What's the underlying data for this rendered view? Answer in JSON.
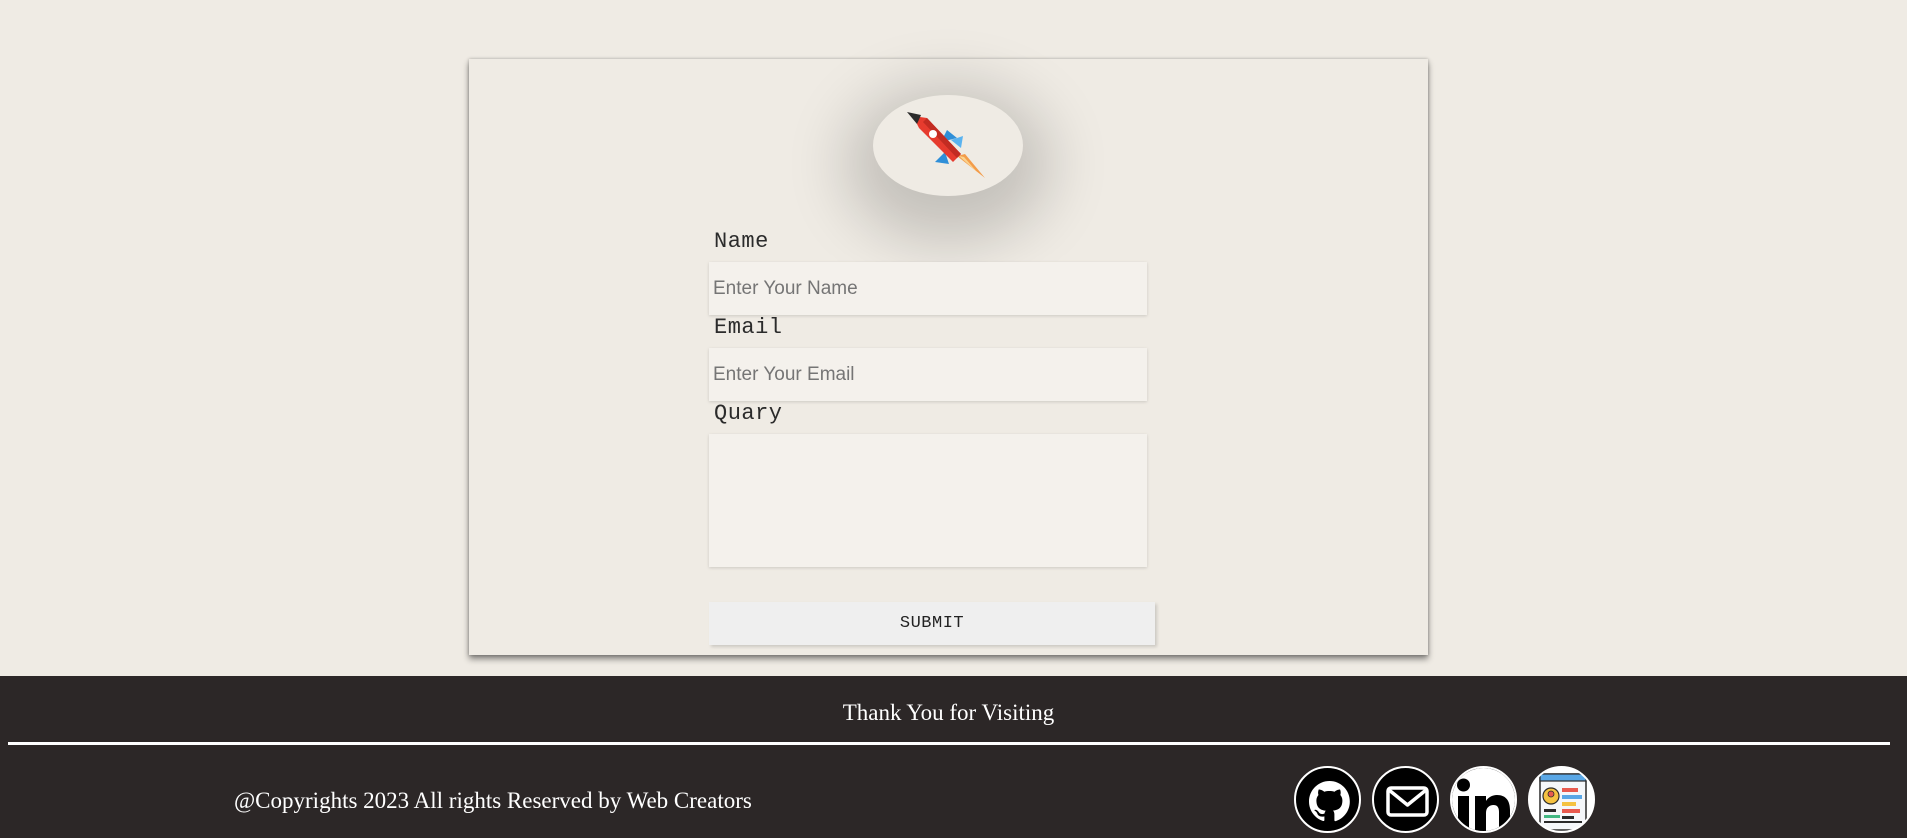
{
  "form": {
    "name_label": "Name",
    "name_placeholder": "Enter Your Name",
    "email_label": "Email",
    "email_placeholder": "Enter Your Email",
    "query_label": "Quary",
    "submit_label": "SUBMIT"
  },
  "footer": {
    "thanks": "Thank You for Visiting",
    "copyright": "@Copyrights 2023 All rights Reserved by Web Creators",
    "social_icons": [
      "github-icon",
      "mail-icon",
      "linkedin-icon",
      "resume-icon"
    ]
  },
  "colors": {
    "background": "#efebe4",
    "footer_background": "#2c2727",
    "footer_text": "#ffffff"
  }
}
